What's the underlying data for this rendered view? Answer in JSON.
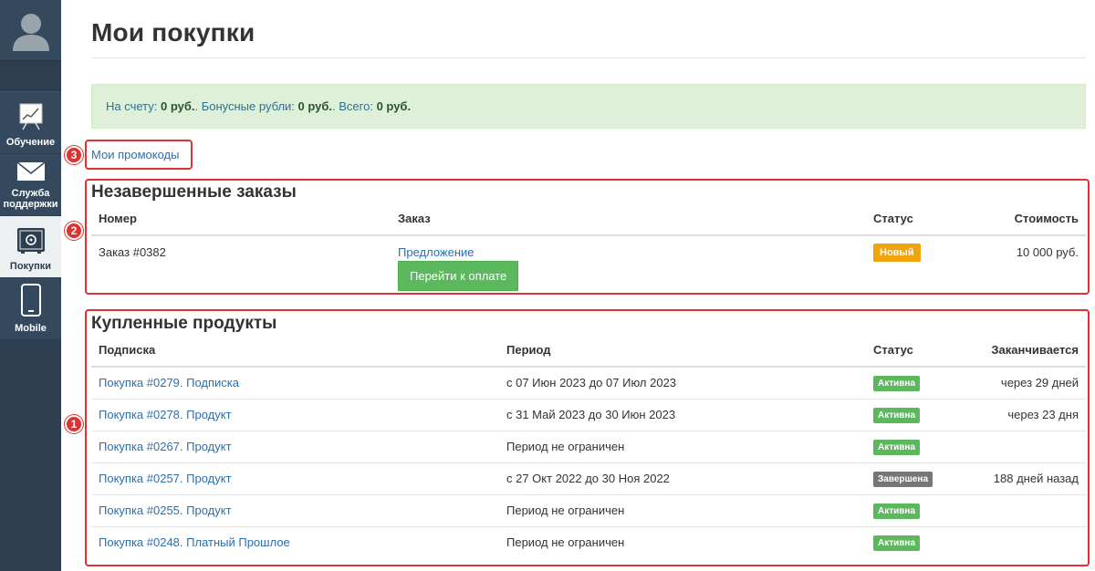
{
  "sidebar": {
    "items": [
      {
        "label": "Обучение",
        "icon": "chart-board-icon"
      },
      {
        "label": "Служба поддержки",
        "icon": "envelope-icon"
      },
      {
        "label": "Покупки",
        "icon": "safe-icon"
      },
      {
        "label": "Mobile",
        "icon": "phone-icon"
      }
    ]
  },
  "page": {
    "title": "Мои покупки"
  },
  "balance": {
    "account_label": "На счету:",
    "account_value": "0 руб.",
    "bonus_label": ". Бонусные рубли:",
    "bonus_value": "0 руб.",
    "total_label": ". Всего:",
    "total_value": "0 руб."
  },
  "promo": {
    "link": "Мои промокоды"
  },
  "annotations": {
    "one": "1",
    "two": "2",
    "three": "3"
  },
  "pending": {
    "title": "Незавершенные заказы",
    "headers": {
      "number": "Номер",
      "order": "Заказ",
      "status": "Статус",
      "cost": "Стоимость"
    },
    "row": {
      "number": "Заказ #0382",
      "order_link": "Предложение",
      "pay_button": "Перейти к оплате",
      "status": "Новый",
      "cost": "10 000 руб."
    }
  },
  "purchased": {
    "title": "Купленные продукты",
    "headers": {
      "subscription": "Подписка",
      "period": "Период",
      "status": "Статус",
      "ends": "Заканчивается"
    },
    "rows": [
      {
        "name": "Покупка #0279. Подписка",
        "period": "с 07 Июн 2023 до 07 Июл 2023",
        "status": "Активна",
        "ends": "через 29 дней"
      },
      {
        "name": "Покупка #0278. Продукт",
        "period": "с 31 Май 2023 до 30 Июн 2023",
        "status": "Активна",
        "ends": "через 23 дня"
      },
      {
        "name": "Покупка #0267. Продукт",
        "period": "Период не ограничен",
        "status": "Активна",
        "ends": ""
      },
      {
        "name": "Покупка #0257. Продукт",
        "period": "с 27 Окт 2022 до 30 Ноя 2022",
        "status": "Завершена",
        "ends": "188 дней назад"
      },
      {
        "name": "Покупка #0255. Продукт",
        "period": "Период не ограничен",
        "status": "Активна",
        "ends": ""
      },
      {
        "name": "Покупка #0248. Платный Прошлое",
        "period": "Период не ограничен",
        "status": "Активна",
        "ends": ""
      }
    ]
  },
  "colors": {
    "sidebar_bg": "#2c3e50",
    "link": "#2a6faf",
    "status_new": "#f0a30a",
    "status_active": "#5cb85c",
    "status_done": "#777777",
    "annotation": "#e03131",
    "alert_bg": "#dff0d8"
  }
}
